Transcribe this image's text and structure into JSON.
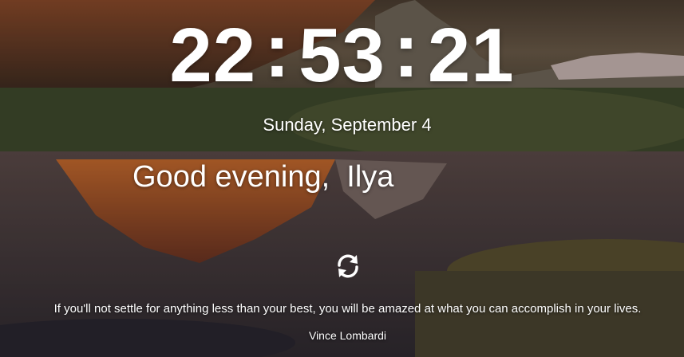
{
  "clock": {
    "hours": "22",
    "minutes": "53",
    "seconds": "21",
    "separator": ":"
  },
  "date": "Sunday, September 4",
  "greeting": "Good evening,  Ilya",
  "refresh_icon": "refresh-icon",
  "quote": {
    "text": "If you'll not settle for anything less than your best, you will be amazed at what you can accomplish in your lives.",
    "author": "Vince Lombardi"
  },
  "colors": {
    "text": "#ffffff",
    "background_sky": "#4a4233",
    "background_water": "#3b302c",
    "mountain_glow": "#b8612a"
  }
}
